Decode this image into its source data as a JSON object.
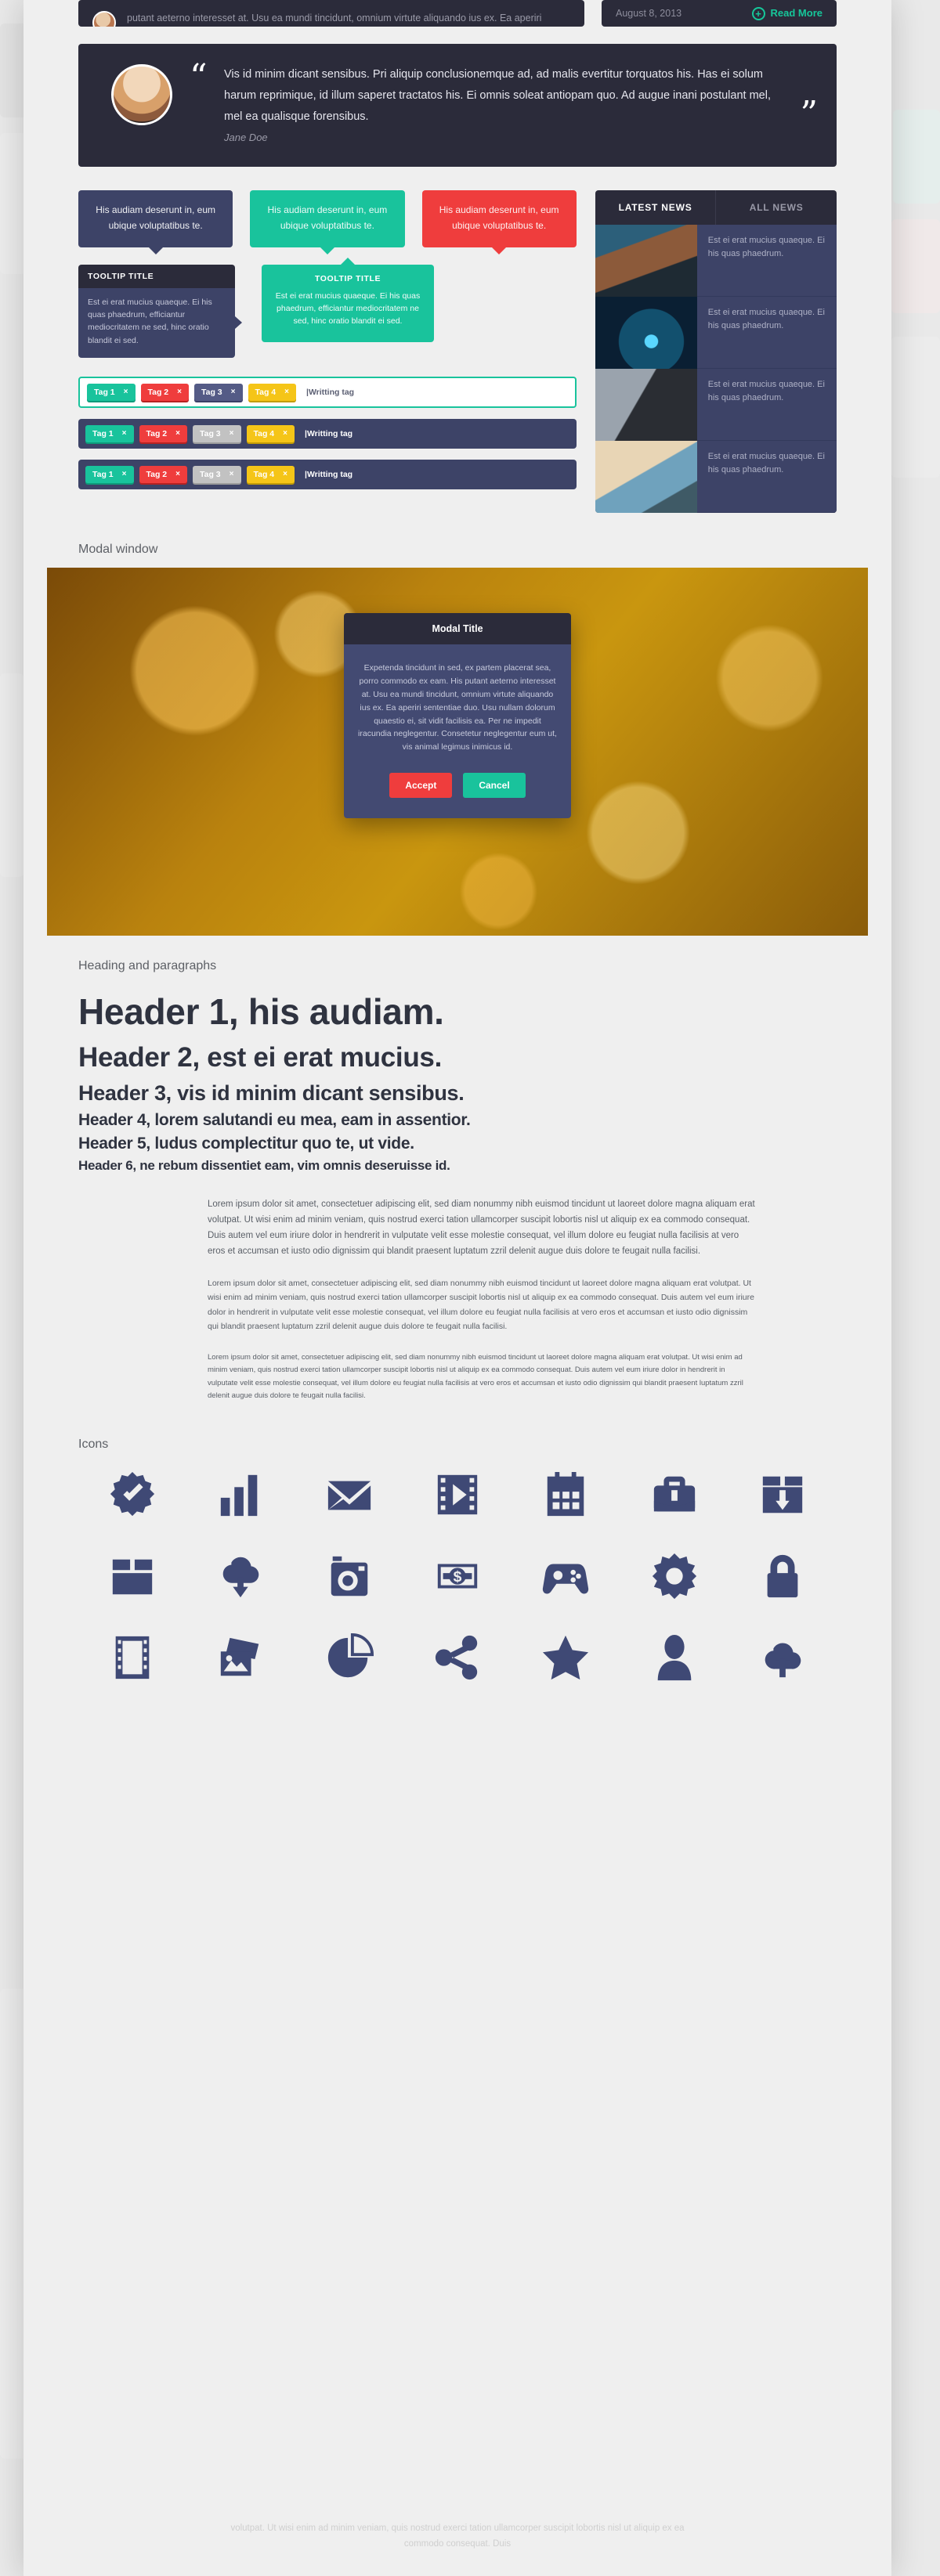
{
  "top": {
    "excerpt": "putant aeterno interesset at. Usu ea mundi tincidunt, omnium virtute aliquando ius ex. Ea aperiri sententiae duo. Usu nullam dolorum quaestio ei, sit vidit facilisis ea.",
    "date": "August 8, 2013",
    "read_more": "Read More",
    "plus_glyph": "+"
  },
  "testimonial": {
    "quote": "Vis id minim dicant sensibus. Pri aliquip conclusionemque ad, ad malis evertitur torquatos his. Has ei solum harum reprimique, id illum saperet tractatos his. Ei omnis soleat antiopam quo. Ad augue inani postulant mel, mel ea qualisque forensibus.",
    "author": "Jane Doe",
    "open_quote": "“",
    "close_quote": "”"
  },
  "bubbles": [
    {
      "text": "His audiam deserunt in, eum ubique voluptatibus te.",
      "color": "navy"
    },
    {
      "text": "His audiam deserunt in, eum ubique voluptatibus te.",
      "color": "green"
    },
    {
      "text": "His audiam deserunt in, eum ubique voluptatibus te.",
      "color": "red"
    }
  ],
  "tooltip_dark": {
    "title": "TOOLTIP TITLE",
    "body": "Est ei erat mucius quaeque. Ei his quas phaedrum, efficiantur mediocritatem ne sed, hinc oratio blandit ei sed."
  },
  "tooltip_green": {
    "title": "TOOLTIP TITLE",
    "body": "Est ei erat mucius quaeque. Ei his quas phaedrum, efficiantur mediocritatem ne sed, hinc oratio blandit ei sed."
  },
  "tag_rows": [
    {
      "style": "white",
      "placeholder": "|Writting tag",
      "tags": [
        {
          "label": "Tag 1",
          "color": "green",
          "close": "×"
        },
        {
          "label": "Tag 2",
          "color": "red",
          "close": "×"
        },
        {
          "label": "Tag 3",
          "color": "navy",
          "close": "×"
        },
        {
          "label": "Tag 4",
          "color": "yellow",
          "close": "×"
        }
      ]
    },
    {
      "style": "navy",
      "placeholder": "|Writting tag",
      "tags": [
        {
          "label": "Tag 1",
          "color": "green",
          "close": "×"
        },
        {
          "label": "Tag 2",
          "color": "red",
          "close": "×"
        },
        {
          "label": "Tag 3",
          "color": "gray",
          "close": "×"
        },
        {
          "label": "Tag 4",
          "color": "yellow",
          "close": "×"
        }
      ]
    },
    {
      "style": "navy2",
      "placeholder": "|Writting tag",
      "tags": [
        {
          "label": "Tag 1",
          "color": "green",
          "close": "×"
        },
        {
          "label": "Tag 2",
          "color": "red",
          "close": "×"
        },
        {
          "label": "Tag 3",
          "color": "gray",
          "close": "×"
        },
        {
          "label": "Tag 4",
          "color": "yellow",
          "close": "×"
        }
      ]
    }
  ],
  "news": {
    "tabs": [
      {
        "label": "LATEST NEWS",
        "active": true
      },
      {
        "label": "ALL NEWS",
        "active": false
      }
    ],
    "items": [
      {
        "text": "Est ei erat mucius quaeque. Ei his quas phaedrum.",
        "thumb": "th1"
      },
      {
        "text": "Est ei erat mucius quaeque. Ei his quas phaedrum.",
        "thumb": "th2"
      },
      {
        "text": "Est ei erat mucius quaeque. Ei his quas phaedrum.",
        "thumb": "th3"
      },
      {
        "text": "Est ei erat mucius quaeque. Ei his quas phaedrum.",
        "thumb": "th4"
      }
    ]
  },
  "modal_section": {
    "label": "Modal window",
    "title": "Modal Title",
    "body": "Expetenda tincidunt in sed, ex partem placerat sea, porro commodo ex eam. His putant aeterno interesset at. Usu ea mundi tincidunt, omnium virtute aliquando ius ex. Ea aperiri sententiae duo. Usu nullam dolorum quaestio ei, sit vidit facilisis ea. Per ne impedit iracundia neglegentur. Consetetur neglegentur eum ut, vis animal legimus inimicus id.",
    "accept": "Accept",
    "cancel": "Cancel"
  },
  "headings_section": {
    "label": "Heading and paragraphs",
    "h1": "Header 1, his audiam.",
    "h2": "Header 2, est ei erat mucius.",
    "h3": "Header 3, vis id minim dicant sensibus.",
    "h4": "Header 4, lorem salutandi eu mea, eam in assentior.",
    "h5": "Header 5, ludus complectitur quo te, ut vide.",
    "h6": "Header 6, ne rebum dissentiet eam, vim omnis deseruisse id."
  },
  "paragraphs": [
    "Lorem ipsum dolor sit amet, consectetuer adipiscing elit, sed diam nonummy nibh euismod tincidunt ut laoreet dolore magna aliquam erat volutpat. Ut wisi enim ad minim veniam, quis nostrud exerci tation ullamcorper suscipit lobortis nisl ut aliquip ex ea commodo consequat. Duis autem vel eum iriure dolor in hendrerit in vulputate velit esse molestie consequat, vel illum dolore eu feugiat nulla facilisis at vero eros et accumsan et iusto odio dignissim qui blandit praesent luptatum zzril delenit augue duis dolore te feugait nulla facilisi.",
    "Lorem ipsum dolor sit amet, consectetuer adipiscing elit, sed diam nonummy nibh euismod tincidunt ut laoreet dolore magna aliquam erat volutpat. Ut wisi enim ad minim veniam, quis nostrud exerci tation ullamcorper suscipit lobortis nisl ut aliquip ex ea commodo consequat. Duis autem vel eum iriure dolor in hendrerit in vulputate velit esse molestie consequat, vel illum dolore eu feugiat nulla facilisis at vero eros et accumsan et iusto odio dignissim qui blandit praesent luptatum zzril delenit augue duis dolore te feugait nulla facilisi.",
    "Lorem ipsum dolor sit amet, consectetuer adipiscing elit, sed diam nonummy nibh euismod tincidunt ut laoreet dolore magna aliquam erat volutpat. Ut wisi enim ad minim veniam, quis nostrud exerci tation ullamcorper suscipit lobortis nisl ut aliquip ex ea commodo consequat. Duis autem vel eum iriure dolor in hendrerit in vulputate velit esse molestie consequat, vel illum dolore eu feugiat nulla facilisis at vero eros et accumsan et iusto odio dignissim qui blandit praesent luptatum zzril delenit augue duis dolore te feugait nulla facilisi."
  ],
  "icons_section": {
    "label": "Icons",
    "accent_color": "#3f4975",
    "icons": [
      "badge-check-icon",
      "bar-chart-icon",
      "envelope-icon",
      "film-play-icon",
      "calendar-icon",
      "briefcase-icon",
      "box-download-icon",
      "open-box-icon",
      "cloud-download-icon",
      "camera-icon",
      "money-icon",
      "gamepad-icon",
      "gear-icon",
      "lock-icon",
      "film-strip-icon",
      "photos-icon",
      "pie-chart-icon",
      "share-icon",
      "star-icon",
      "user-icon",
      "cloud-upload-icon"
    ]
  },
  "ghost_bottom": "volutpat. Ut wisi enim ad minim veniam, quis nostrud exerci tation ullamcorper suscipit lobortis nisl ut aliquip ex ea commodo consequat. Duis"
}
